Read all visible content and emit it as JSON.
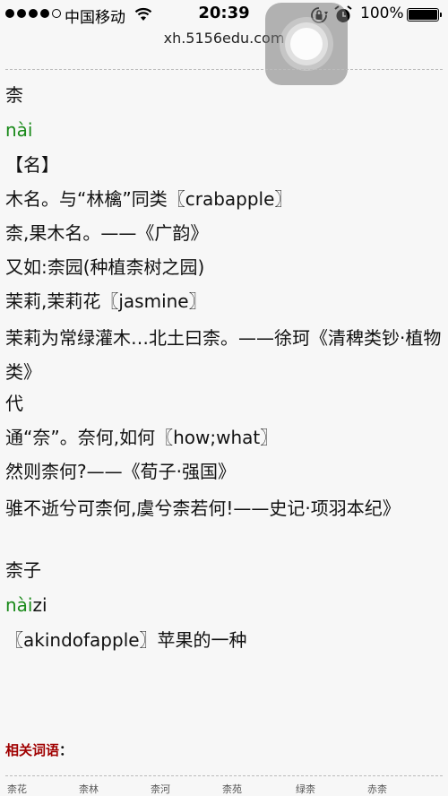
{
  "status_bar": {
    "carrier": "中国移动",
    "time": "20:39",
    "battery": "100%"
  },
  "browser": {
    "url": "xh.5156edu.com"
  },
  "entry1": {
    "char": "柰",
    "pinyin": "nài",
    "pos": "【名】",
    "l1": "木名。与“林檎”同类〖crabapple〗",
    "l2": "柰,果木名。——《广韵》",
    "l3": "又如:柰园(种植柰树之园)",
    "l4": "茉莉,茉莉花〖jasmine〗",
    "l5": "茉莉为常绿灌木…北土曰柰。——徐珂《清稗类钞·植物类》",
    "l6": "代",
    "l7": "通“奈”。奈何,如何〖how;what〗",
    "l8": "然则柰何?——《荀子·强国》",
    "l9": "骓不逝兮可柰何,虞兮柰若何!——史记·项羽本纪》"
  },
  "entry2": {
    "word": "柰子",
    "pinyin_prefix": "nài",
    "pinyin_suffix": "zi",
    "def": "〖akindofapple〗苹果的一种"
  },
  "related": {
    "label": "相关词语",
    "colon": "："
  },
  "related_words": [
    "柰花",
    "柰林",
    "柰河",
    "柰苑",
    "绿柰",
    "赤柰"
  ]
}
